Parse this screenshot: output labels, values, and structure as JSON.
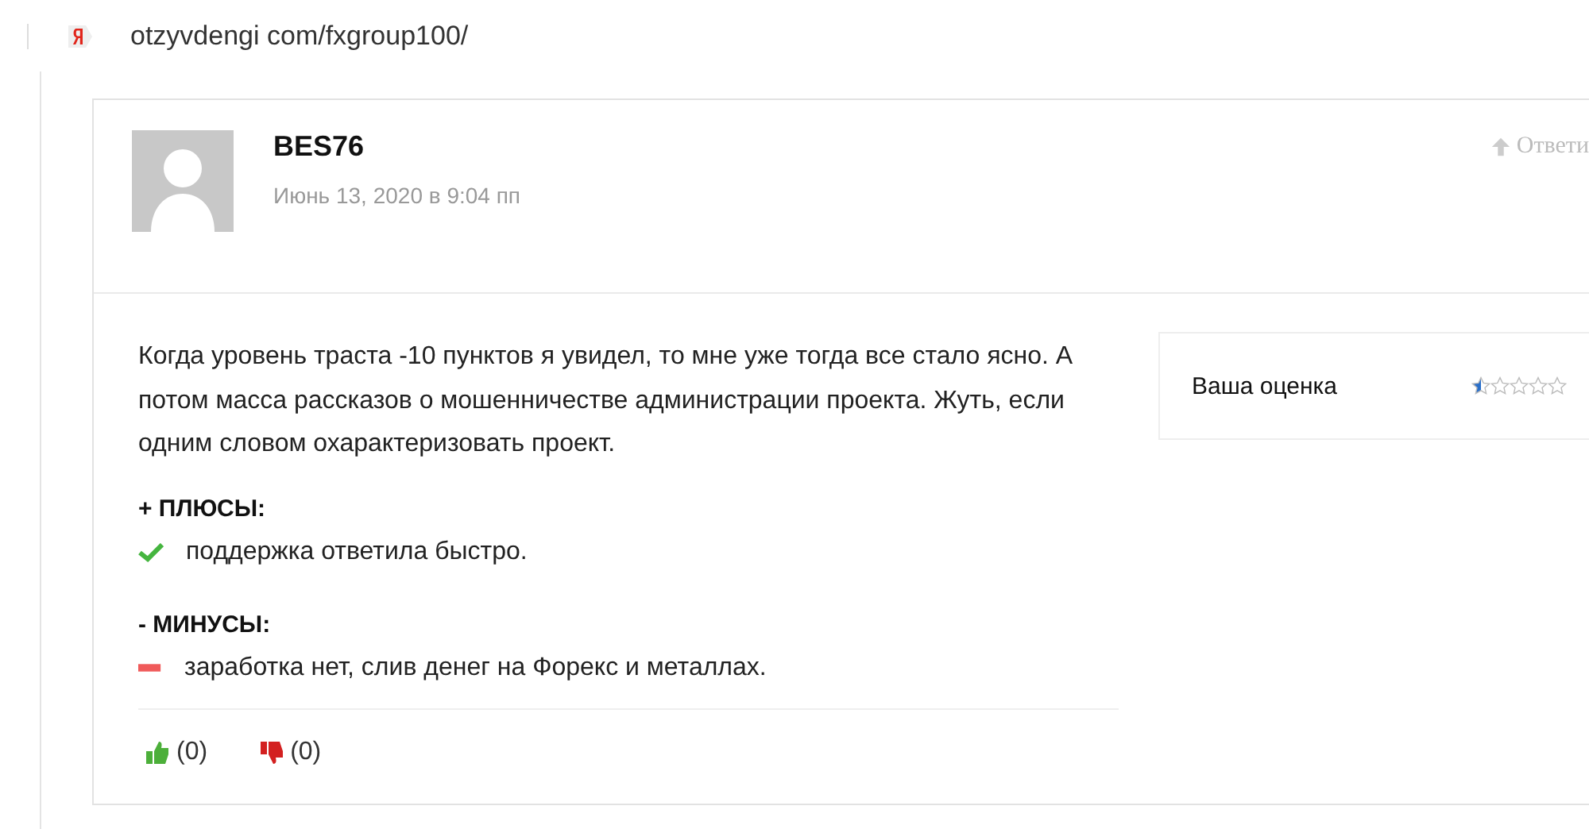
{
  "address_bar": {
    "url": "otzyvdengi com/fxgroup100/"
  },
  "review": {
    "author": "BES76",
    "date": "Июнь 13, 2020 в 9:04 пп",
    "reply": "Ответи",
    "text": "Когда уровень траста -10 пунктов я увидел, то мне уже тогда все стало ясно. А потом масса рассказов о мошенничестве администрации проекта. Жуть, если одним словом охарактеризовать проект.",
    "rating": {
      "label": "Ваша оценка",
      "stars": 0.5
    },
    "pros": {
      "heading": "+ ПЛЮСЫ:",
      "items": [
        "поддержка ответила быстро."
      ]
    },
    "cons": {
      "heading": "- МИНУСЫ:",
      "items": [
        "заработка нет, слив денег на Форекс и металлах."
      ]
    },
    "likes": "(0)",
    "dislikes": "(0)"
  }
}
